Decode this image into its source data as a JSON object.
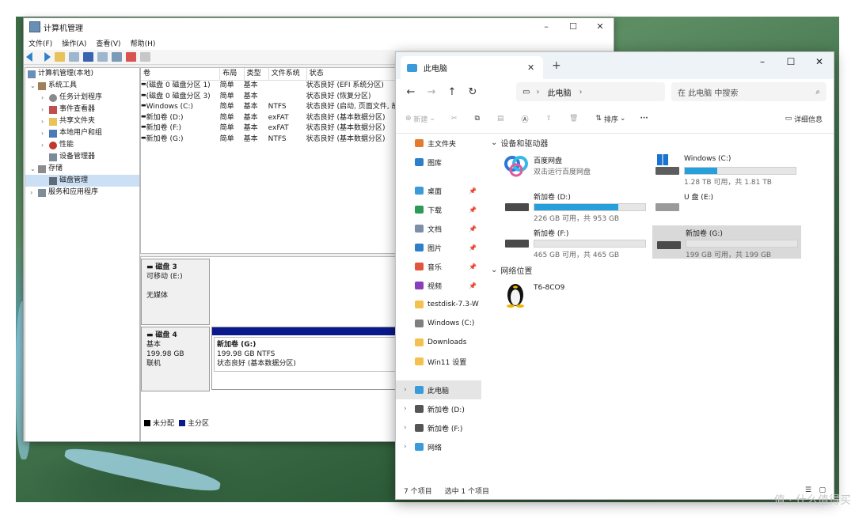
{
  "comp_mgmt": {
    "title": "计算机管理",
    "menu": [
      "文件(F)",
      "操作(A)",
      "查看(V)",
      "帮助(H)"
    ],
    "tree": [
      {
        "label": "计算机管理(本地)",
        "level": 0,
        "arrow": ""
      },
      {
        "label": "系统工具",
        "level": 1,
        "arrow": "⌄"
      },
      {
        "label": "任务计划程序",
        "level": 2,
        "arrow": "›"
      },
      {
        "label": "事件查看器",
        "level": 2,
        "arrow": "›"
      },
      {
        "label": "共享文件夹",
        "level": 2,
        "arrow": "›"
      },
      {
        "label": "本地用户和组",
        "level": 2,
        "arrow": "›"
      },
      {
        "label": "性能",
        "level": 2,
        "arrow": "›"
      },
      {
        "label": "设备管理器",
        "level": 2,
        "arrow": ""
      },
      {
        "label": "存储",
        "level": 1,
        "arrow": "⌄"
      },
      {
        "label": "磁盘管理",
        "level": 2,
        "arrow": ""
      },
      {
        "label": "服务和应用程序",
        "level": 1,
        "arrow": "›"
      }
    ],
    "columns": [
      "卷",
      "布局",
      "类型",
      "文件系统",
      "状态"
    ],
    "rows": [
      [
        "(磁盘 0 磁盘分区 1)",
        "简单",
        "基本",
        "",
        "状态良好 (EFI 系统分区)"
      ],
      [
        "(磁盘 0 磁盘分区 3)",
        "简单",
        "基本",
        "",
        "状态良好 (恢复分区)"
      ],
      [
        "Windows (C:)",
        "简单",
        "基本",
        "NTFS",
        "状态良好 (启动, 页面文件, 故"
      ],
      [
        "新加卷 (D:)",
        "简单",
        "基本",
        "exFAT",
        "状态良好 (基本数据分区)"
      ],
      [
        "新加卷 (F:)",
        "简单",
        "基本",
        "exFAT",
        "状态良好 (基本数据分区)"
      ],
      [
        "新加卷 (G:)",
        "简单",
        "基本",
        "NTFS",
        "状态良好 (基本数据分区)"
      ]
    ],
    "disk3": {
      "name": "磁盘 3",
      "line1": "可移动 (E:)",
      "line2": "无媒体"
    },
    "disk4": {
      "name": "磁盘 4",
      "line1": "基本",
      "line2": "199.98 GB",
      "line3": "联机",
      "vol_name": "新加卷  (G:)",
      "vol_size": "199.98 GB NTFS",
      "vol_status": "状态良好 (基本数据分区)"
    },
    "legend": [
      "未分配",
      "主分区"
    ]
  },
  "explorer": {
    "tab_title": "此电脑",
    "address": "此电脑",
    "search_placeholder": "在 此电脑 中搜索",
    "commands": {
      "new": "新建",
      "sort": "排序",
      "details": "详细信息"
    },
    "sidebar": [
      {
        "label": "主文件夹",
        "color": "#e47a2e",
        "pin": false
      },
      {
        "label": "图库",
        "color": "#2f7fc8",
        "pin": false
      },
      {
        "label": "桌面",
        "color": "#3a9bd8",
        "pin": true
      },
      {
        "label": "下载",
        "color": "#2e9a55",
        "pin": true
      },
      {
        "label": "文档",
        "color": "#7b8fa6",
        "pin": true
      },
      {
        "label": "图片",
        "color": "#2f7fc8",
        "pin": true
      },
      {
        "label": "音乐",
        "color": "#e0563c",
        "pin": true
      },
      {
        "label": "视频",
        "color": "#8a3fb8",
        "pin": true
      },
      {
        "label": "testdisk-7.3-W",
        "color": "#f2c14e",
        "pin": false
      },
      {
        "label": "Windows (C:)",
        "color": "#7f7f7f",
        "pin": false
      },
      {
        "label": "Downloads",
        "color": "#f2c14e",
        "pin": false
      },
      {
        "label": "Win11 设置",
        "color": "#f2c14e",
        "pin": false
      },
      {
        "label": "此电脑",
        "color": "#3a9bd8",
        "pin": false
      },
      {
        "label": "新加卷 (D:)",
        "color": "#555555",
        "pin": false
      },
      {
        "label": "新加卷 (F:)",
        "color": "#555555",
        "pin": false
      },
      {
        "label": "网络",
        "color": "#3a9bd8",
        "pin": false
      }
    ],
    "group_devices": "设备和驱动器",
    "group_network": "网络位置",
    "baidu": {
      "name": "百度网盘",
      "sub": "双击运行百度网盘"
    },
    "drives": [
      {
        "name": "Windows (C:)",
        "size": "1.28 TB 可用，共 1.81 TB",
        "used": 0.29
      },
      {
        "name": "新加卷 (D:)",
        "size": "226 GB 可用，共 953 GB",
        "used": 0.76
      },
      {
        "name": "U 盘 (E:)",
        "size": "",
        "used": 0
      },
      {
        "name": "新加卷 (F:)",
        "size": "465 GB 可用，共 465 GB",
        "used": 0.0
      },
      {
        "name": "新加卷 (G:)",
        "size": "199 GB 可用，共 199 GB",
        "used": 0.0
      }
    ],
    "network_item": "T6-8CO9",
    "status_count": "7 个项目",
    "status_selected": "选中 1 个项目"
  },
  "watermark": "值 · 什么值得买"
}
